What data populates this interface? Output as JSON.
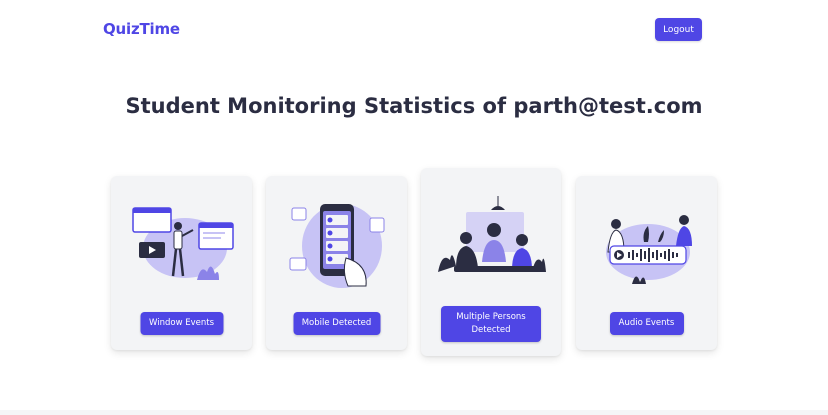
{
  "app": {
    "brand": "QuizTime"
  },
  "header": {
    "logout_label": "Logout"
  },
  "main": {
    "title": "Student Monitoring Statistics of parth@test.com"
  },
  "cards": [
    {
      "illustration": "presentation-illustration",
      "button_label": "Window Events"
    },
    {
      "illustration": "mobile-phone-illustration",
      "button_label": "Mobile Detected"
    },
    {
      "illustration": "group-meeting-illustration",
      "button_label": "Multiple Persons Detected"
    },
    {
      "illustration": "audio-wave-illustration",
      "button_label": "Audio Events"
    }
  ],
  "colors": {
    "accent": "#4f46e5",
    "card_bg": "#f3f4f6",
    "illustration_purple": "#8b83e8",
    "text_dark": "#2b2d42"
  }
}
